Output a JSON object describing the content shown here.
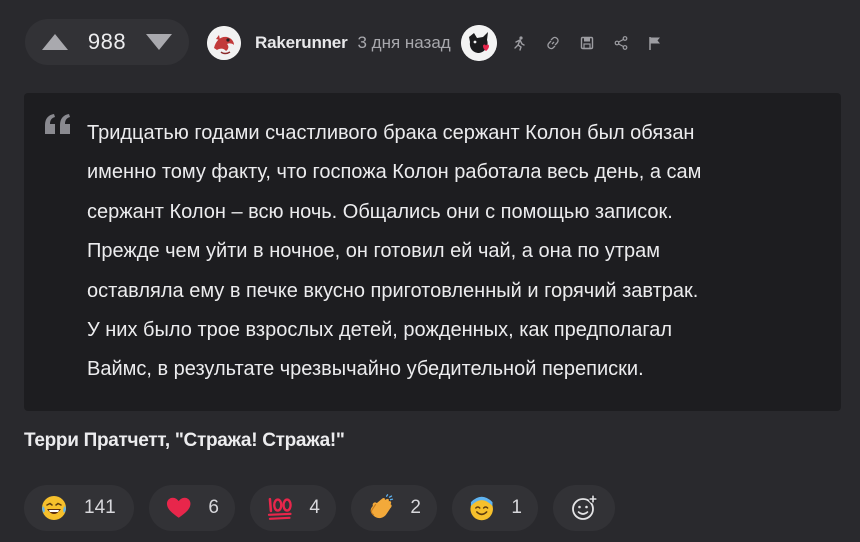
{
  "vote": {
    "score": "988",
    "up_icon": "triangle-up-icon",
    "down_icon": "triangle-down-icon"
  },
  "author": {
    "name": "Rakerunner",
    "time": "3 дня назад",
    "avatar_icon": "dragon-avatar-icon",
    "badge_icon": "dog-heart-badge-icon"
  },
  "actions": [
    {
      "icon": "running-icon"
    },
    {
      "icon": "link-icon"
    },
    {
      "icon": "save-icon"
    },
    {
      "icon": "share-icon"
    },
    {
      "icon": "flag-icon"
    }
  ],
  "quote": {
    "icon": "quote-mark-icon",
    "lines": [
      "Тридцатью годами счастливого брака сержант Колон был обязан",
      "именно тому факту, что госпожа Колон работала весь день, а сам",
      "сержант Колон – всю ночь. Общались они с помощью записок.",
      "Прежде чем уйти в ночное, он готовил ей чай, а она по утрам",
      "оставляла ему в печке вкусно приготовленный и горячий завтрак.",
      "У них было трое взрослых детей, рожденных, как предполагал",
      "Ваймс, в результате чрезвычайно убедительной переписки."
    ]
  },
  "attribution": "Терри Пратчетт, \"Стража! Стража!\"",
  "reactions": [
    {
      "icon": "laughing-emoji-icon",
      "count": "141"
    },
    {
      "icon": "heart-emoji-icon",
      "count": "6"
    },
    {
      "icon": "hundred-emoji-icon",
      "count": "4"
    },
    {
      "icon": "clapping-hands-emoji-icon",
      "count": "2"
    },
    {
      "icon": "smiling-face-emoji-icon",
      "count": "1"
    },
    {
      "icon": "add-reaction-icon"
    }
  ],
  "colors": {
    "background": "#29292d",
    "pill": "#323236",
    "quote_bg": "#1d1d20",
    "text": "#ececee",
    "muted": "#a8a8ad",
    "heart": "#e8264b"
  }
}
